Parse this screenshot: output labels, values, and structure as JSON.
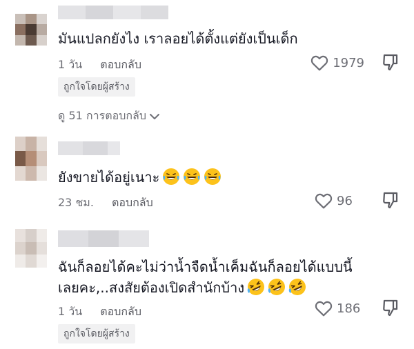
{
  "comments": [
    {
      "text": "มันแปลกยังไง เราลอยได้ตั้งแต่ยังเป็นเด็ก",
      "time": "1 วัน",
      "reply_label": "ตอบกลับ",
      "likes": "1979",
      "badge": "ถูกใจโดยผู้สร้าง",
      "emojis": []
    },
    {
      "text": "ยังขายได้อยู่เนาะ",
      "time": "23 ชม.",
      "reply_label": "ตอบกลับ",
      "likes": "96",
      "emojis": [
        "grinning-sweat-emoji",
        "grinning-sweat-emoji",
        "grinning-sweat-emoji"
      ]
    },
    {
      "text_line1": "ฉันก็ลอยได้คะไม่ว่าน้ำจืดน้ำเค็มฉันก็ลอยได้แบบนี้",
      "text_line2": "เลยคะ,..สงสัยต้องเปิดสำนักบ้าง",
      "time": "1 วัน",
      "reply_label": "ตอบกลับ",
      "likes": "186",
      "badge": "ถูกใจโดยผู้สร้าง",
      "emojis": [
        "rolling-laughing-emoji",
        "rolling-laughing-emoji",
        "rolling-laughing-emoji"
      ]
    }
  ],
  "view_replies": "ดู 51 การตอบกลับ",
  "colors": {
    "text": "#161823",
    "muted": "#6d6e75",
    "badge_bg": "#f1f1f2",
    "emoji_yellow": "#fcc21b"
  }
}
